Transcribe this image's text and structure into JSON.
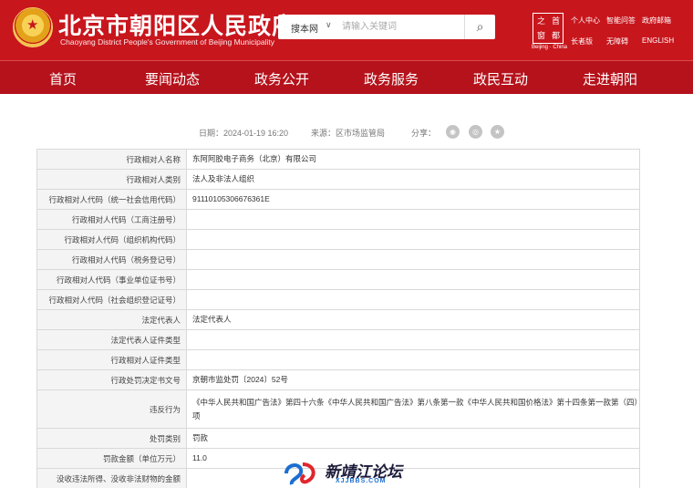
{
  "header": {
    "title": "北京市朝阳区人民政府",
    "subtitle": "Chaoyang District People's Government of Beijing Municipality",
    "logo_chars": [
      "首",
      "都",
      "之",
      "窗"
    ],
    "logo_caption": "Beijing · China"
  },
  "search": {
    "scope": "搜本网",
    "placeholder": "请输入关键词"
  },
  "top_links": [
    "个人中心",
    "智能问答",
    "政府邮箱",
    "长者版",
    "无障碍",
    "ENGLISH"
  ],
  "nav": [
    "首页",
    "要闻动态",
    "政务公开",
    "政务服务",
    "政民互动",
    "走进朝阳"
  ],
  "meta": {
    "date": "日期：2024-01-19 16:20",
    "source": "来源：区市场监管局",
    "share": "分享："
  },
  "share_icons": [
    "wechat-icon",
    "weibo-icon",
    "qzone-icon"
  ],
  "table_rows": [
    {
      "label": "行政相对人名称",
      "value": "东阿阿胶电子商务（北京）有限公司"
    },
    {
      "label": "行政相对人类别",
      "value": "法人及非法人组织"
    },
    {
      "label": "行政相对人代码（统一社会信用代码）",
      "value": "91110105306676361E"
    },
    {
      "label": "行政相对人代码（工商注册号）",
      "value": ""
    },
    {
      "label": "行政相对人代码（组织机构代码）",
      "value": ""
    },
    {
      "label": "行政相对人代码（税务登记号）",
      "value": ""
    },
    {
      "label": "行政相对人代码（事业单位证书号）",
      "value": ""
    },
    {
      "label": "行政相对人代码（社会组织登记证号）",
      "value": ""
    },
    {
      "label": "法定代表人",
      "value": "法定代表人"
    },
    {
      "label": "法定代表人证件类型",
      "value": ""
    },
    {
      "label": "行政相对人证件类型",
      "value": ""
    },
    {
      "label": "行政处罚决定书文号",
      "value": "京朝市监处罚〔2024〕52号"
    },
    {
      "label": "违反行为",
      "value": "《中华人民共和国广告法》第四十六条《中华人民共和国广告法》第八条第一款《中华人民共和国价格法》第十四条第一款第（四）项"
    },
    {
      "label": "处罚类别",
      "value": "罚款"
    },
    {
      "label": "罚款金额（单位万元）",
      "value": "11.0"
    },
    {
      "label": "没收违法所得、没收非法财物的金额",
      "value": ""
    }
  ],
  "watermark": {
    "brand": "新靖江论坛",
    "domain": "XJJBBS.COM"
  },
  "colors": {
    "header_red": "#c8161d",
    "nav_red": "#b5121b",
    "label_bg": "#f4f4f4"
  }
}
